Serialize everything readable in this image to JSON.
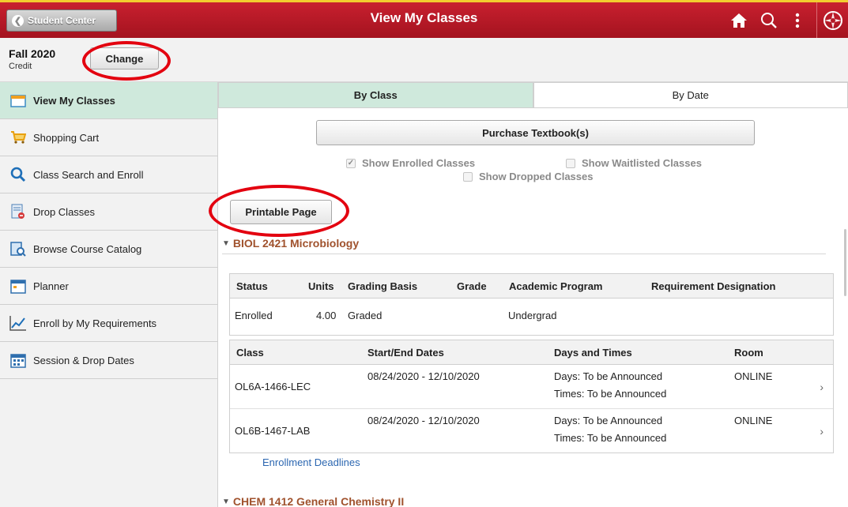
{
  "header": {
    "back_label": "Student Center",
    "title": "View My Classes",
    "icons": [
      "home-icon",
      "search-icon",
      "more-actions-icon",
      "navbar-compass-icon"
    ]
  },
  "term": {
    "name": "Fall 2020",
    "career": "Credit",
    "change_label": "Change"
  },
  "sidebar": {
    "items": [
      {
        "label": "View My Classes",
        "icon": "calendar-icon",
        "active": true
      },
      {
        "label": "Shopping Cart",
        "icon": "shopping-cart-icon"
      },
      {
        "label": "Class Search and Enroll",
        "icon": "search-icon"
      },
      {
        "label": "Drop Classes",
        "icon": "drop-icon"
      },
      {
        "label": "Browse Course Catalog",
        "icon": "catalog-icon"
      },
      {
        "label": "Planner",
        "icon": "planner-icon"
      },
      {
        "label": "Enroll by My Requirements",
        "icon": "chart-icon"
      },
      {
        "label": "Session & Drop Dates",
        "icon": "calendar-grid-icon"
      }
    ]
  },
  "tabs": [
    {
      "label": "By Class",
      "active": true
    },
    {
      "label": "By Date"
    }
  ],
  "actions": {
    "purchase_label": "Purchase Textbook(s)",
    "printable_label": "Printable Page"
  },
  "filters": {
    "enrolled": {
      "label": "Show Enrolled Classes",
      "checked": true
    },
    "waitlisted": {
      "label": "Show Waitlisted Classes",
      "checked": false
    },
    "dropped": {
      "label": "Show Dropped Classes",
      "checked": false
    }
  },
  "courses": [
    {
      "title": "BIOL 2421 Microbiology",
      "summary_headers": [
        "Status",
        "Units",
        "Grading Basis",
        "Grade",
        "Academic Program",
        "Requirement Designation"
      ],
      "summary": {
        "status": "Enrolled",
        "units": "4.00",
        "grading": "Graded",
        "grade": "",
        "program": "Undergrad",
        "requirement": ""
      },
      "section_headers": [
        "Class",
        "Start/End Dates",
        "Days and Times",
        "Room"
      ],
      "sections": [
        {
          "class": "OL6A-1466-LEC",
          "dates": "08/24/2020 - 12/10/2020",
          "days": "Days: To be Announced",
          "times": "Times: To be Announced",
          "room": "ONLINE"
        },
        {
          "class": "OL6B-1467-LAB",
          "dates": "08/24/2020 - 12/10/2020",
          "days": "Days: To be Announced",
          "times": "Times: To be Announced",
          "room": "ONLINE"
        }
      ],
      "deadlines_label": "Enrollment Deadlines"
    },
    {
      "title": "CHEM 1412 General Chemistry II"
    }
  ],
  "colors": {
    "header_red": "#b51a27",
    "accent_green": "#cfe9dc",
    "course_title": "#a0522d",
    "link_blue": "#2c67b1",
    "annotation_red": "#e3000f"
  }
}
